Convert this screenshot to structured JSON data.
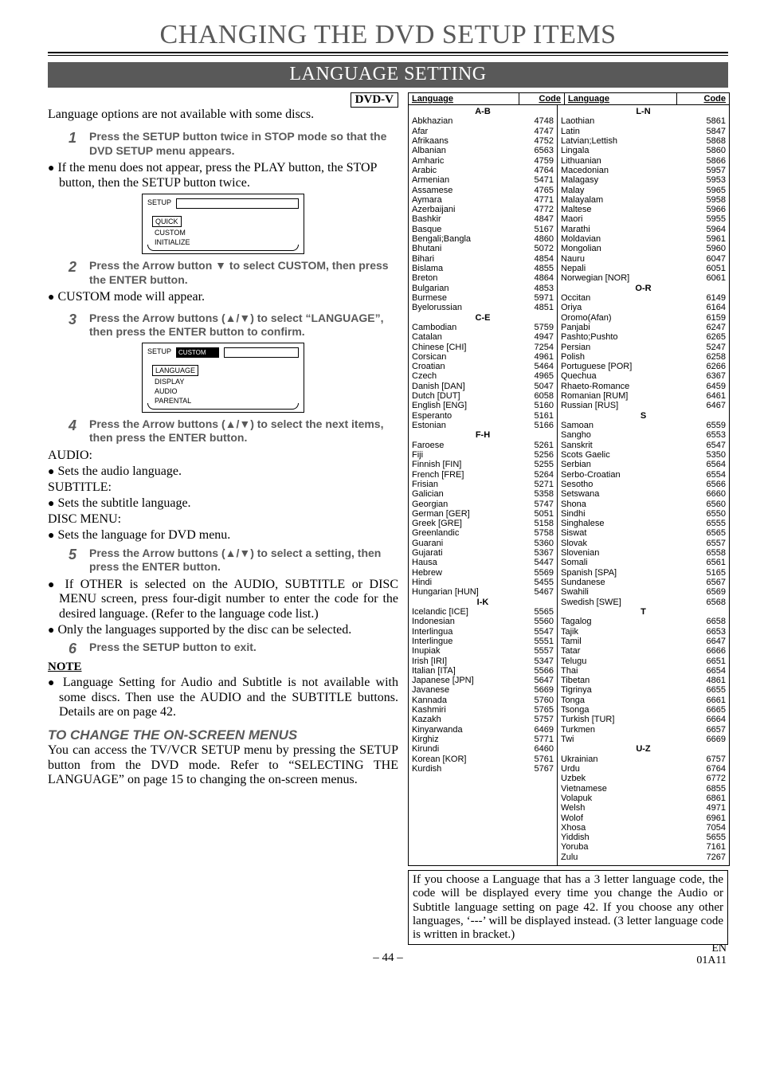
{
  "title": "CHANGING THE DVD SETUP ITEMS",
  "sub_bar": "LANGUAGE SETTING",
  "dvd_badge": "DVD-V",
  "intro": "Language options are not available with some discs.",
  "step1": "Press the SETUP button twice in STOP mode so that the DVD SETUP menu appears.",
  "bullet_after_1": "If the menu does not appear, press the PLAY button, the STOP button, then the SETUP button twice.",
  "osd1": {
    "setup": "SETUP",
    "quick": "QUICK",
    "custom": "CUSTOM",
    "init": "INITIALIZE"
  },
  "step2": "Press the Arrow button ▼ to select CUSTOM, then press the ENTER button.",
  "bullet_after_2": "CUSTOM mode will appear.",
  "step3": "Press the Arrow buttons (▲/▼) to select “LANGUAGE”, then press the ENTER button to confirm.",
  "osd2": {
    "setup": "SETUP",
    "custom": "CUSTOM",
    "language": "LANGUAGE",
    "display": "DISPLAY",
    "audio": "AUDIO",
    "parental": "PARENTAL"
  },
  "step4": "Press the Arrow buttons (▲/▼) to select the next items, then press the ENTER button.",
  "hd_audio": "AUDIO:",
  "b_audio": "Sets the audio language.",
  "hd_sub": "SUBTITLE:",
  "b_sub": "Sets the subtitle language.",
  "hd_disc": "DISC MENU:",
  "b_disc": "Sets the language for DVD menu.",
  "step5": "Press the Arrow buttons (▲/▼) to select a setting, then press the ENTER button.",
  "bullet5a": "If OTHER is selected on the AUDIO, SUBTITLE or DISC MENU screen, press four-digit number to enter the code for the desired language. (Refer to the language code list.)",
  "bullet5b": "Only the languages supported by the disc can be selected.",
  "step6": "Press the SETUP button to exit.",
  "note_hd": "NOTE",
  "note_bullet": "Language Setting for Audio and Subtitle is not available with some discs. Then use the AUDIO and the SUBTITLE buttons. Details are on page 42.",
  "onscreen_h": "TO CHANGE THE ON-SCREEN MENUS",
  "onscreen_p": "You can access the TV/VCR SETUP menu by pressing the SETUP button from the DVD mode. Refer to “SELECTING THE LANGUAGE” on page 15 to changing the on-screen menus.",
  "table_head": {
    "lang": "Language",
    "code": "Code"
  },
  "sections_left": [
    {
      "h": "A-B",
      "rows": [
        [
          "Abkhazian",
          "4748"
        ],
        [
          "Afar",
          "4747"
        ],
        [
          "Afrikaans",
          "4752"
        ],
        [
          "Albanian",
          "6563"
        ],
        [
          "Amharic",
          "4759"
        ],
        [
          "Arabic",
          "4764"
        ],
        [
          "Armenian",
          "5471"
        ],
        [
          "Assamese",
          "4765"
        ],
        [
          "Aymara",
          "4771"
        ],
        [
          "Azerbaijani",
          "4772"
        ],
        [
          "Bashkir",
          "4847"
        ],
        [
          "Basque",
          "5167"
        ],
        [
          "Bengali;Bangla",
          "4860"
        ],
        [
          "Bhutani",
          "5072"
        ],
        [
          "Bihari",
          "4854"
        ],
        [
          "Bislama",
          "4855"
        ],
        [
          "Breton",
          "4864"
        ],
        [
          "Bulgarian",
          "4853"
        ],
        [
          "Burmese",
          "5971"
        ],
        [
          "Byelorussian",
          "4851"
        ]
      ]
    },
    {
      "h": "C-E",
      "rows": [
        [
          "Cambodian",
          "5759"
        ],
        [
          "Catalan",
          "4947"
        ],
        [
          "Chinese [CHI]",
          "7254"
        ],
        [
          "Corsican",
          "4961"
        ],
        [
          "Croatian",
          "5464"
        ],
        [
          "Czech",
          "4965"
        ],
        [
          "Danish [DAN]",
          "5047"
        ],
        [
          "Dutch [DUT]",
          "6058"
        ],
        [
          "English [ENG]",
          "5160"
        ],
        [
          "Esperanto",
          "5161"
        ],
        [
          "Estonian",
          "5166"
        ]
      ]
    },
    {
      "h": "F-H",
      "rows": [
        [
          "Faroese",
          "5261"
        ],
        [
          "Fiji",
          "5256"
        ],
        [
          "Finnish [FIN]",
          "5255"
        ],
        [
          "French [FRE]",
          "5264"
        ],
        [
          "Frisian",
          "5271"
        ],
        [
          "Galician",
          "5358"
        ],
        [
          "Georgian",
          "5747"
        ],
        [
          "German [GER]",
          "5051"
        ],
        [
          "Greek [GRE]",
          "5158"
        ],
        [
          "Greenlandic",
          "5758"
        ],
        [
          "Guarani",
          "5360"
        ],
        [
          "Gujarati",
          "5367"
        ],
        [
          "Hausa",
          "5447"
        ],
        [
          "Hebrew",
          "5569"
        ],
        [
          "Hindi",
          "5455"
        ],
        [
          "Hungarian [HUN]",
          "5467"
        ]
      ]
    },
    {
      "h": "I-K",
      "rows": [
        [
          "Icelandic [ICE]",
          "5565"
        ],
        [
          "Indonesian",
          "5560"
        ],
        [
          "Interlingua",
          "5547"
        ],
        [
          "Interlingue",
          "5551"
        ],
        [
          "Inupiak",
          "5557"
        ],
        [
          "Irish [IRI]",
          "5347"
        ],
        [
          "Italian [ITA]",
          "5566"
        ],
        [
          "Japanese [JPN]",
          "5647"
        ],
        [
          "Javanese",
          "5669"
        ],
        [
          "Kannada",
          "5760"
        ],
        [
          "Kashmiri",
          "5765"
        ],
        [
          "Kazakh",
          "5757"
        ],
        [
          "Kinyarwanda",
          "6469"
        ],
        [
          "Kirghiz",
          "5771"
        ],
        [
          "Kirundi",
          "6460"
        ],
        [
          "Korean [KOR]",
          "5761"
        ],
        [
          "Kurdish",
          "5767"
        ]
      ]
    }
  ],
  "sections_right": [
    {
      "h": "L-N",
      "rows": [
        [
          "Laothian",
          "5861"
        ],
        [
          "Latin",
          "5847"
        ],
        [
          "Latvian;Lettish",
          "5868"
        ],
        [
          "Lingala",
          "5860"
        ],
        [
          "Lithuanian",
          "5866"
        ],
        [
          "Macedonian",
          "5957"
        ],
        [
          "Malagasy",
          "5953"
        ],
        [
          "Malay",
          "5965"
        ],
        [
          "Malayalam",
          "5958"
        ],
        [
          "Maltese",
          "5966"
        ],
        [
          "Maori",
          "5955"
        ],
        [
          "Marathi",
          "5964"
        ],
        [
          "Moldavian",
          "5961"
        ],
        [
          "Mongolian",
          "5960"
        ],
        [
          "Nauru",
          "6047"
        ],
        [
          "Nepali",
          "6051"
        ],
        [
          "Norwegian [NOR]",
          "6061"
        ]
      ]
    },
    {
      "h": "O-R",
      "rows": [
        [
          "Occitan",
          "6149"
        ],
        [
          "Oriya",
          "6164"
        ],
        [
          "Oromo(Afan)",
          "6159"
        ],
        [
          "Panjabi",
          "6247"
        ],
        [
          "Pashto;Pushto",
          "6265"
        ],
        [
          "Persian",
          "5247"
        ],
        [
          "Polish",
          "6258"
        ],
        [
          "Portuguese [POR]",
          "6266"
        ],
        [
          "Quechua",
          "6367"
        ],
        [
          "Rhaeto-Romance",
          "6459"
        ],
        [
          "Romanian [RUM]",
          "6461"
        ],
        [
          "Russian [RUS]",
          "6467"
        ]
      ]
    },
    {
      "h": "S",
      "rows": [
        [
          "Samoan",
          "6559"
        ],
        [
          "Sangho",
          "6553"
        ],
        [
          "Sanskrit",
          "6547"
        ],
        [
          "Scots Gaelic",
          "5350"
        ],
        [
          "Serbian",
          "6564"
        ],
        [
          "Serbo-Croatian",
          "6554"
        ],
        [
          "Sesotho",
          "6566"
        ],
        [
          "Setswana",
          "6660"
        ],
        [
          "Shona",
          "6560"
        ],
        [
          "Sindhi",
          "6550"
        ],
        [
          "Singhalese",
          "6555"
        ],
        [
          "Siswat",
          "6565"
        ],
        [
          "Slovak",
          "6557"
        ],
        [
          "Slovenian",
          "6558"
        ],
        [
          "Somali",
          "6561"
        ],
        [
          "Spanish [SPA]",
          "5165"
        ],
        [
          "Sundanese",
          "6567"
        ],
        [
          "Swahili",
          "6569"
        ],
        [
          "Swedish [SWE]",
          "6568"
        ]
      ]
    },
    {
      "h": "T",
      "rows": [
        [
          "Tagalog",
          "6658"
        ],
        [
          "Tajik",
          "6653"
        ],
        [
          "Tamil",
          "6647"
        ],
        [
          "Tatar",
          "6666"
        ],
        [
          "Telugu",
          "6651"
        ],
        [
          "Thai",
          "6654"
        ],
        [
          "Tibetan",
          "4861"
        ],
        [
          "Tigrinya",
          "6655"
        ],
        [
          "Tonga",
          "6661"
        ],
        [
          "Tsonga",
          "6665"
        ],
        [
          "Turkish [TUR]",
          "6664"
        ],
        [
          "Turkmen",
          "6657"
        ],
        [
          "Twi",
          "6669"
        ]
      ]
    },
    {
      "h": "U-Z",
      "rows": [
        [
          "Ukrainian",
          "6757"
        ],
        [
          "Urdu",
          "6764"
        ],
        [
          "Uzbek",
          "6772"
        ],
        [
          "Vietnamese",
          "6855"
        ],
        [
          "Volapuk",
          "6861"
        ],
        [
          "Welsh",
          "4971"
        ],
        [
          "Wolof",
          "6961"
        ],
        [
          "Xhosa",
          "7054"
        ],
        [
          "Yiddish",
          "5655"
        ],
        [
          "Yoruba",
          "7161"
        ],
        [
          "Zulu",
          "7267"
        ]
      ]
    }
  ],
  "note_box": "If you choose a Language that has a 3 letter language code, the code will be displayed every time you change the Audio or Subtitle language setting on page 42. If you choose any other languages, ‘---’ will be displayed instead. (3 letter language code is written in bracket.)",
  "page_num": "– 44 –",
  "footer_r1": "EN",
  "footer_r2": "01A11"
}
